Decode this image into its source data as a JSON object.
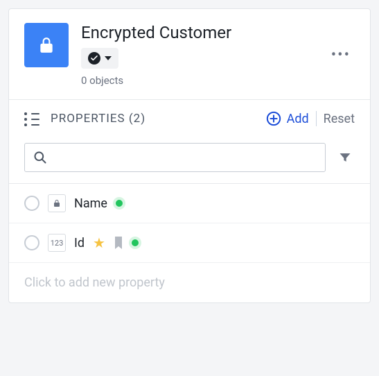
{
  "header": {
    "title": "Encrypted Customer",
    "subtitle": "0 objects"
  },
  "properties": {
    "section_label": "PROPERTIES (2)",
    "add_label": "Add",
    "reset_label": "Reset",
    "search_value": "",
    "items": [
      {
        "name": "Name",
        "type_label": "lock",
        "starred": false,
        "bookmarked": false
      },
      {
        "name": "Id",
        "type_label": "123",
        "starred": true,
        "bookmarked": true
      }
    ],
    "add_new_placeholder": "Click to add new property"
  }
}
